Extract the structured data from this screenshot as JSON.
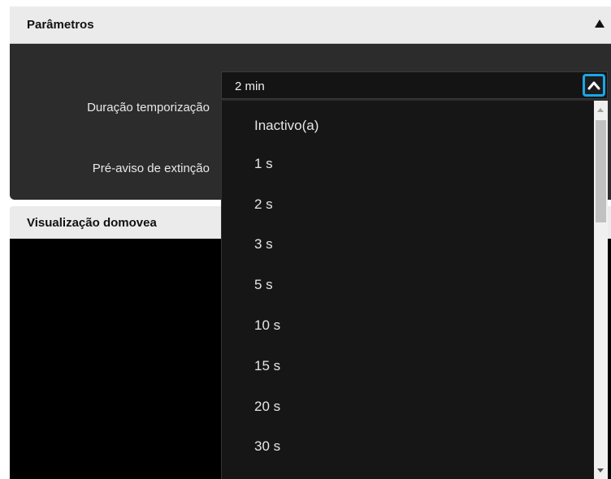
{
  "panel": {
    "title": "Parâmetros",
    "rows": [
      {
        "label": "Duração temporização"
      },
      {
        "label": "Pré-aviso de extinção"
      }
    ]
  },
  "panel2": {
    "title": "Visualização domovea"
  },
  "select": {
    "value": "2 min",
    "options": [
      "Inactivo(a)",
      "1 s",
      "2 s",
      "3 s",
      "5 s",
      "10 s",
      "15 s",
      "20 s",
      "30 s"
    ]
  },
  "icons": {
    "collapse": "triangle-up-icon",
    "toggle": "chevron-up-icon"
  },
  "colors": {
    "accent": "#1aa7e8",
    "panel_bg": "#2c2c2c",
    "header_bg": "#ebebeb",
    "dropdown_bg": "#161616"
  }
}
